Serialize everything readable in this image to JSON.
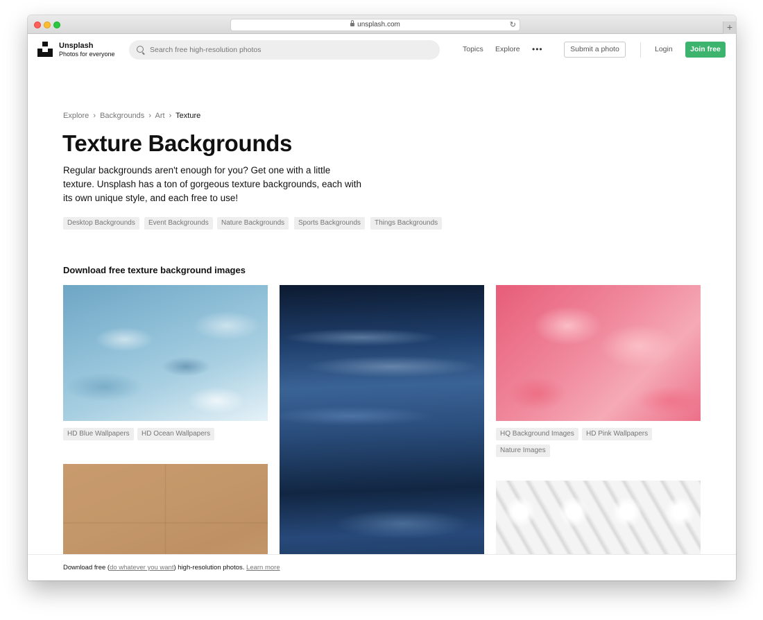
{
  "browser": {
    "url": "unsplash.com"
  },
  "navbar": {
    "brand_name": "Unsplash",
    "brand_tagline": "Photos for everyone",
    "search_placeholder": "Search free high-resolution photos",
    "links": {
      "topics": "Topics",
      "explore": "Explore",
      "more": "•••"
    },
    "submit_label": "Submit a photo",
    "login_label": "Login",
    "join_label": "Join free",
    "join_color": "#3cb46e"
  },
  "breadcrumb": {
    "items": [
      "Explore",
      "Backgrounds",
      "Art",
      "Texture"
    ],
    "separator": "›"
  },
  "page": {
    "title": "Texture Backgrounds",
    "description": "Regular backgrounds aren't enough for you? Get one with a little texture. Unsplash has a ton of gorgeous texture backgrounds, each with its own unique style, and each free to use!"
  },
  "related_tags": [
    "Desktop Backgrounds",
    "Event Backgrounds",
    "Nature Backgrounds",
    "Sports Backgrounds",
    "Things Backgrounds"
  ],
  "gallery": {
    "heading": "Download free texture background images",
    "blue_photo_tags": [
      "HD Blue Wallpapers",
      "HD Ocean Wallpapers"
    ],
    "pink_photo_tags": [
      "HQ Background Images",
      "HD Pink Wallpapers",
      "Nature Images"
    ]
  },
  "footer": {
    "text_before": "Download free (",
    "license_link": "do whatever you want",
    "text_after": ") high-resolution photos. ",
    "learn_more": "Learn more"
  }
}
